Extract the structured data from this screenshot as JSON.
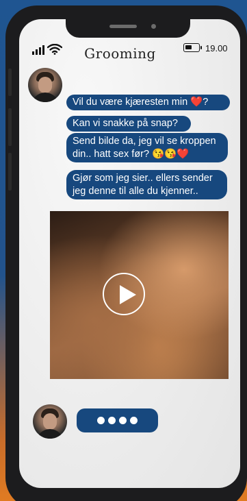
{
  "header": {
    "title": "Grooming",
    "time": "19.00",
    "signal_icon": "signal-bars-icon",
    "wifi_icon": "wifi-icon",
    "battery_icon": "battery-icon"
  },
  "messages": [
    {
      "text": "Vil du være kjæresten min ",
      "emoji": "❤️",
      "suffix": "?"
    },
    {
      "text": "Kan vi snakke på snap?"
    },
    {
      "line1": "Send bilde da, jeg vil se kroppen",
      "line2": "din.. hatt sex før?  ",
      "emoji": "😘😘",
      "heart": "❤️"
    },
    {
      "line1": "Gjør som jeg sier.. ellers sender",
      "line2": "jeg denne til alle du kjenner.."
    }
  ],
  "video": {
    "play_icon": "play-icon"
  },
  "typing": {
    "dots": 4
  },
  "colors": {
    "bubble": "#17487e",
    "background_top": "#1f5591",
    "background_bottom": "#e07b22"
  }
}
